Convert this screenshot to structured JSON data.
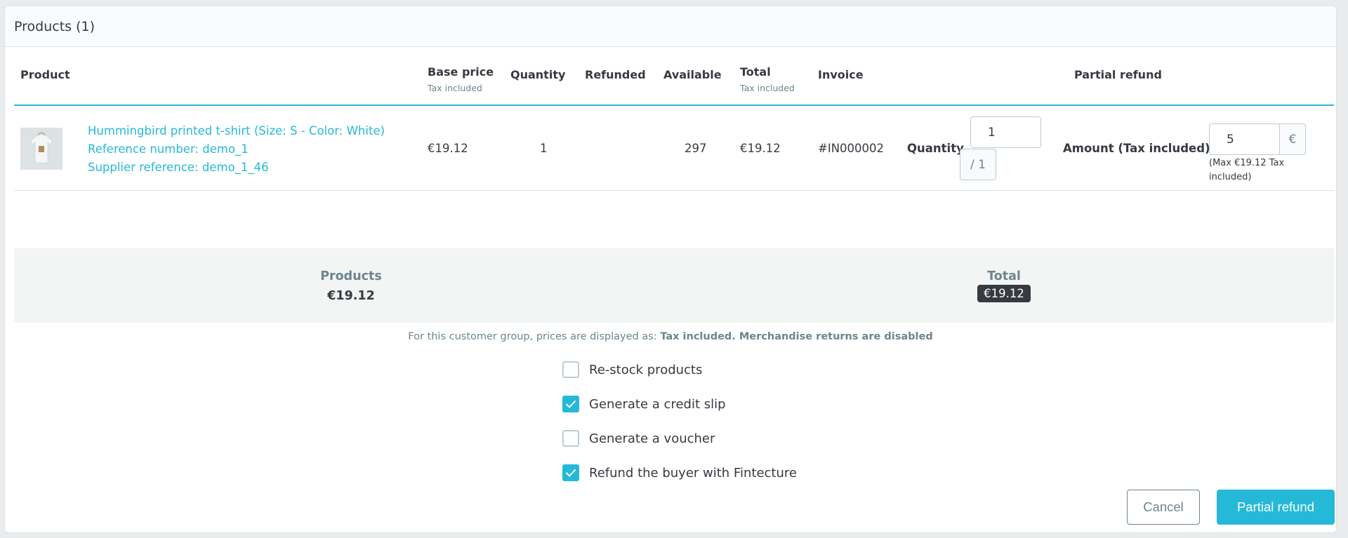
{
  "card": {
    "title": "Products (1)"
  },
  "table": {
    "headers": {
      "product": "Product",
      "base_price": "Base price",
      "base_price_sub": "Tax included",
      "quantity": "Quantity",
      "refunded": "Refunded",
      "available": "Available",
      "total": "Total",
      "total_sub": "Tax included",
      "invoice": "Invoice",
      "partial_refund": "Partial refund"
    },
    "rows": [
      {
        "image": "tshirt-thumbnail",
        "name": "Hummingbird printed t-shirt (Size: S - Color: White)",
        "reference": "Reference number: demo_1",
        "supplier_reference": "Supplier reference: demo_1_46",
        "base_price": "€19.12",
        "quantity": "1",
        "refunded": "",
        "available": "297",
        "total": "€19.12",
        "invoice": "#IN000002",
        "refund_quantity_label": "Quantity",
        "refund_quantity_value": "1",
        "refund_quantity_max": "/ 1",
        "amount_label": "Amount (Tax included)",
        "amount_value": "5",
        "amount_currency": "€",
        "amount_hint": "(Max €19.12 Tax included)"
      }
    ]
  },
  "summary": {
    "products_label": "Products",
    "products_value": "€19.12",
    "total_label": "Total",
    "total_value": "€19.12"
  },
  "notice": {
    "prefix": "For this customer group, prices are displayed as: ",
    "tax_mode": "Tax included",
    "separator": ". ",
    "returns": "Merchandise returns are disabled"
  },
  "options": [
    {
      "label": "Re-stock products",
      "checked": false
    },
    {
      "label": "Generate a credit slip",
      "checked": true
    },
    {
      "label": "Generate a voucher",
      "checked": false
    },
    {
      "label": "Refund the buyer with Fintecture",
      "checked": true
    }
  ],
  "buttons": {
    "cancel": "Cancel",
    "submit": "Partial refund"
  },
  "colors": {
    "accent": "#25b9d7",
    "dark": "#363a41",
    "muted": "#6c868e"
  }
}
